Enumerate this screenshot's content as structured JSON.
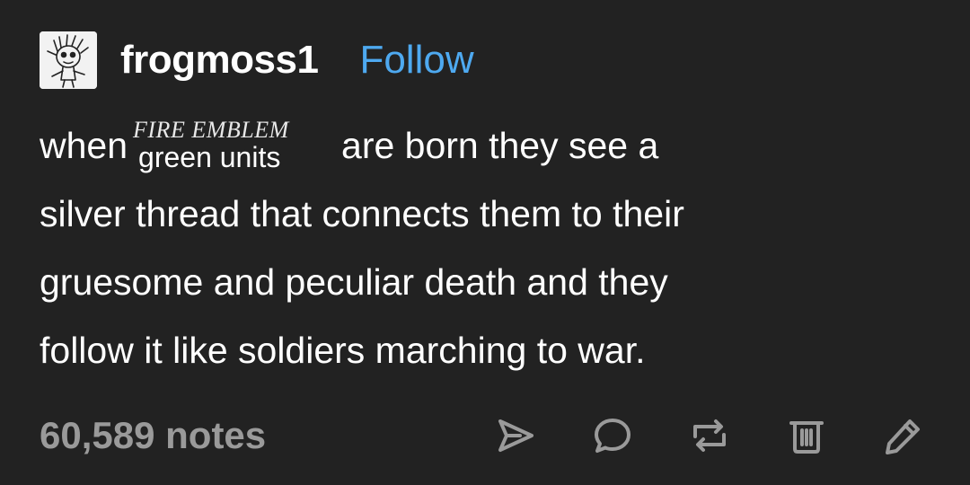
{
  "post": {
    "username": "frogmoss1",
    "follow_label": "Follow",
    "body": {
      "line1_start": "when",
      "overlay_logo_text": "FIRE EMBLEM",
      "overlay_text": "green units",
      "line1_end": "are born they see a",
      "line2": "silver thread that connects them to their",
      "line3": "gruesome and peculiar death and they",
      "line4": "follow it like soldiers marching to war."
    },
    "notes": "60,589 notes"
  },
  "icons": {
    "share": "send-icon",
    "reply": "chat-bubble-icon",
    "reblog": "reblog-icon",
    "delete": "trash-icon",
    "edit": "pencil-icon"
  },
  "colors": {
    "background": "#222222",
    "text": "#ffffff",
    "link": "#4ea9f0",
    "muted": "#9a9a9a"
  }
}
